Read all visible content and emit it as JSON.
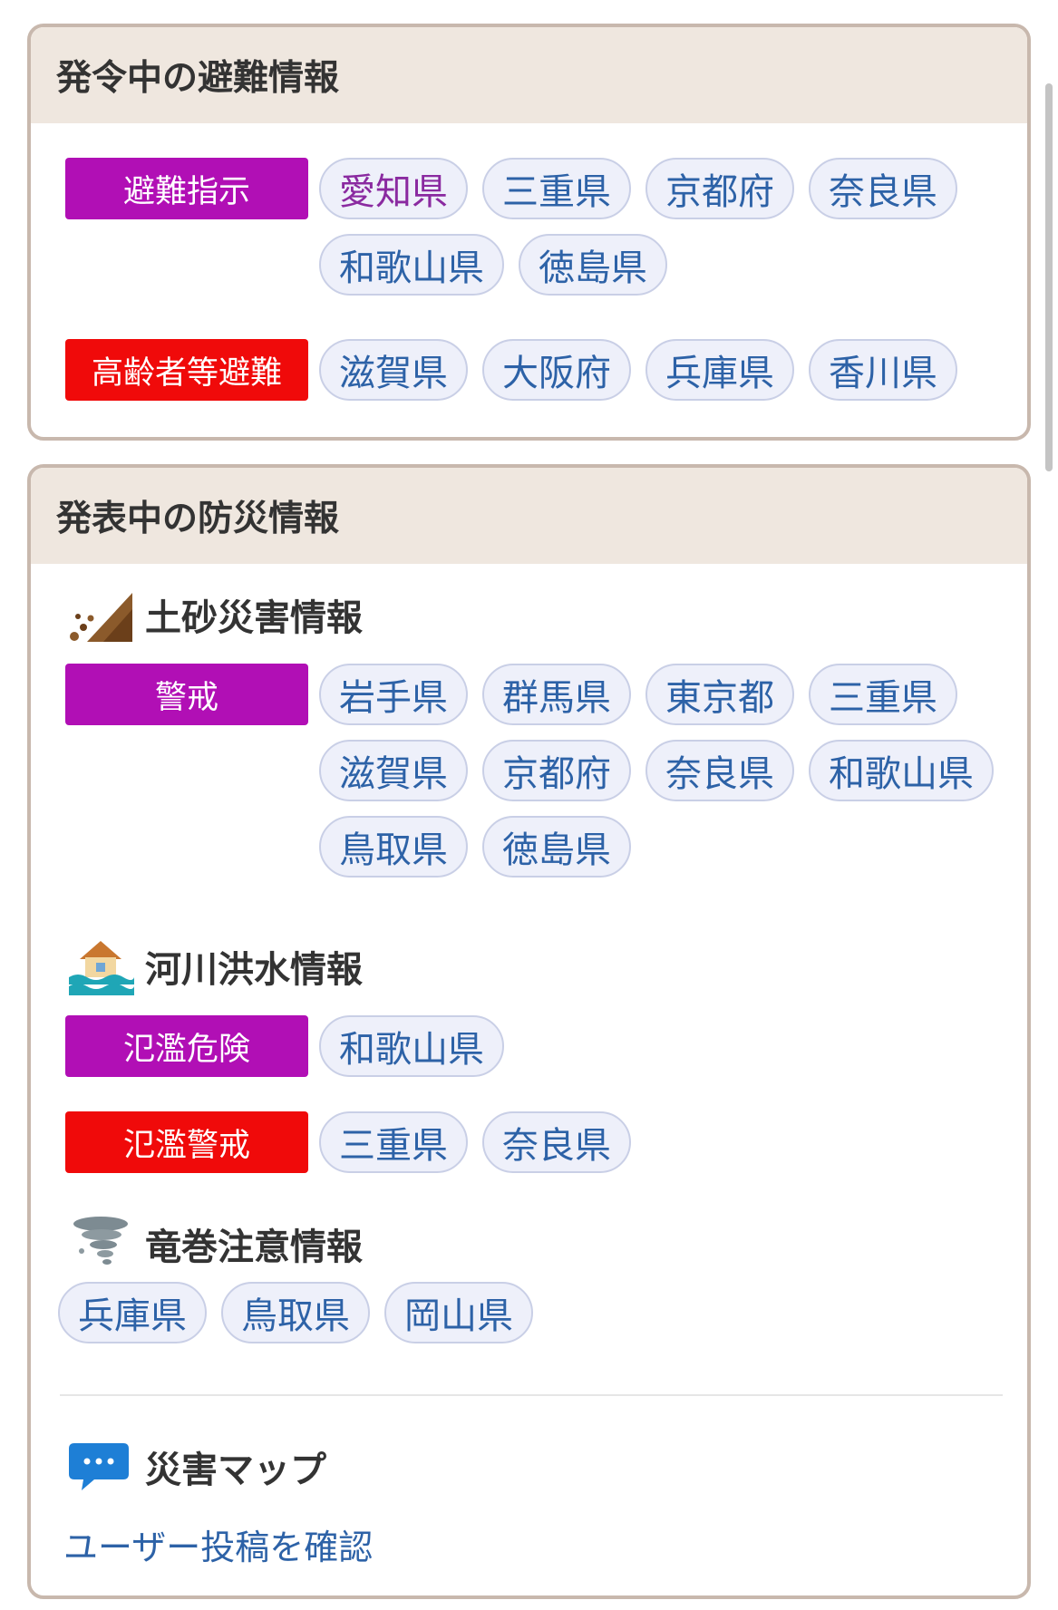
{
  "evacuation": {
    "title": "発令中の避難情報",
    "groups": [
      {
        "label": "避難指示",
        "color": "#b10fb5",
        "prefectures": [
          "愛知県",
          "三重県",
          "京都府",
          "奈良県",
          "和歌山県",
          "徳島県"
        ]
      },
      {
        "label": "高齢者等避難",
        "color": "#f00a0a",
        "prefectures": [
          "滋賀県",
          "大阪府",
          "兵庫県",
          "香川県"
        ]
      }
    ]
  },
  "disaster": {
    "title": "発表中の防災情報",
    "landslide": {
      "title": "土砂災害情報",
      "icon": "landslide-icon",
      "label": "警戒",
      "color": "#b10fb5",
      "prefectures": [
        "岩手県",
        "群馬県",
        "東京都",
        "三重県",
        "滋賀県",
        "京都府",
        "奈良県",
        "和歌山県",
        "鳥取県",
        "徳島県"
      ]
    },
    "flood": {
      "title": "河川洪水情報",
      "icon": "flood-house-icon",
      "groups": [
        {
          "label": "氾濫危険",
          "color": "#b10fb5",
          "prefectures": [
            "和歌山県"
          ]
        },
        {
          "label": "氾濫警戒",
          "color": "#f00a0a",
          "prefectures": [
            "三重県",
            "奈良県"
          ]
        }
      ]
    },
    "tornado": {
      "title": "竜巻注意情報",
      "icon": "tornado-icon",
      "prefectures": [
        "兵庫県",
        "鳥取県",
        "岡山県"
      ]
    },
    "map": {
      "title": "災害マップ",
      "icon": "speech-bubble-icon",
      "link": "ユーザー投稿を確認"
    }
  }
}
